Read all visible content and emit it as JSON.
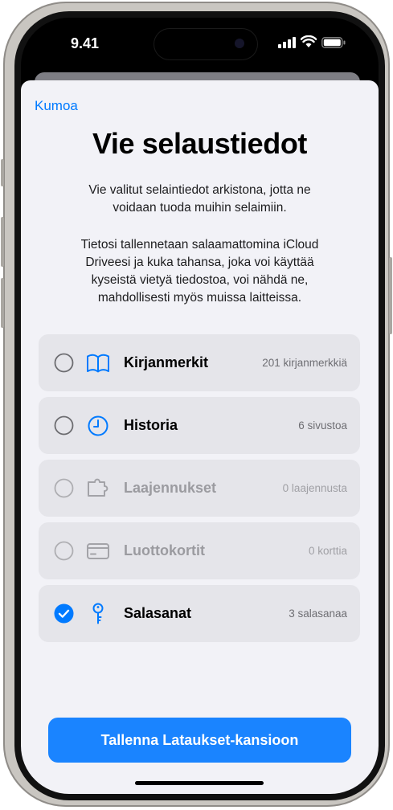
{
  "status_bar": {
    "time": "9.41"
  },
  "sheet": {
    "cancel_label": "Kumoa",
    "title": "Vie selaustiedot",
    "description": "Vie valitut selaintiedot arkistona, jotta ne\nvoidaan tuoda muihin selaimiin.",
    "warning": "Tietosi tallennetaan salaamattomina iCloud\nDriveesi ja kuka tahansa, joka voi käyttää\nkyseistä vietyä tiedostoa, voi nähdä ne,\nmahdollisesti myös muissa laitteissa."
  },
  "options": [
    {
      "label": "Kirjanmerkit",
      "count": "201 kirjanmerkkiä",
      "icon": "book-icon",
      "checked": false,
      "enabled": true
    },
    {
      "label": "Historia",
      "count": "6 sivustoa",
      "icon": "clock-icon",
      "checked": false,
      "enabled": true
    },
    {
      "label": "Laajennukset",
      "count": "0 laajennusta",
      "icon": "puzzle-piece-icon",
      "checked": false,
      "enabled": false
    },
    {
      "label": "Luottokortit",
      "count": "0 korttia",
      "icon": "credit-card-icon",
      "checked": false,
      "enabled": false
    },
    {
      "label": "Salasanat",
      "count": "3 salasanaa",
      "icon": "key-icon",
      "checked": true,
      "enabled": true
    }
  ],
  "save_button_label": "Tallenna Lataukset-kansioon",
  "colors": {
    "accent": "#007aff",
    "button": "#1a84ff",
    "sheet_bg": "#f2f2f7",
    "row_bg": "#e5e5ea",
    "disabled_text": "#9b9ba0"
  }
}
